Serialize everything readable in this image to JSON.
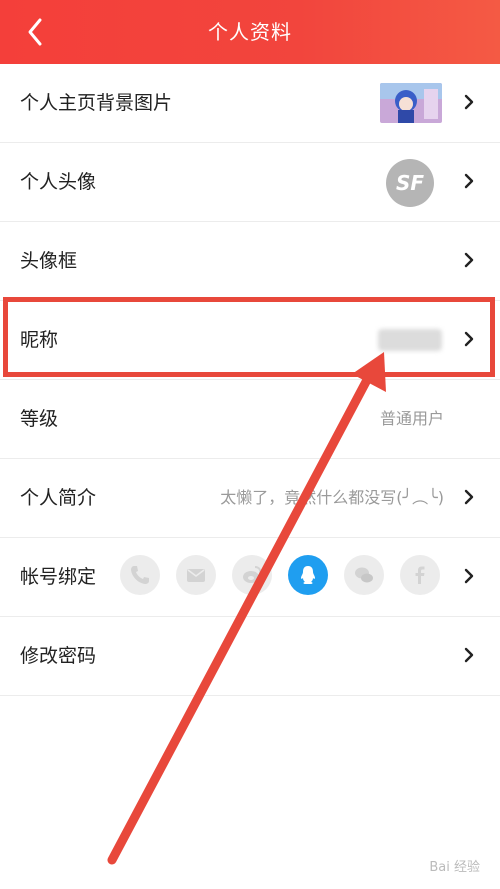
{
  "header": {
    "title": "个人资料"
  },
  "rows": [
    {
      "label": "个人主页背景图片",
      "value": ""
    },
    {
      "label": "个人头像",
      "value": ""
    },
    {
      "label": "头像框",
      "value": ""
    },
    {
      "label": "昵称",
      "value": ""
    },
    {
      "label": "等级",
      "value": "普通用户"
    },
    {
      "label": "个人简介",
      "value": "太懒了，竟然什么都没写(╯︵╰)"
    },
    {
      "label": "帐号绑定",
      "value": ""
    },
    {
      "label": "修改密码",
      "value": ""
    }
  ],
  "avatar": {
    "text": "SF"
  },
  "bindings": [
    {
      "icon": "phone-icon",
      "bound": false
    },
    {
      "icon": "mail-icon",
      "bound": false
    },
    {
      "icon": "weibo-icon",
      "bound": false
    },
    {
      "icon": "qq-icon",
      "bound": true
    },
    {
      "icon": "wechat-icon",
      "bound": false
    },
    {
      "icon": "facebook-icon",
      "bound": false
    }
  ],
  "colors": {
    "accent": "#f43f3a",
    "highlight": "#e8483b",
    "qq": "#1f9ef0"
  },
  "watermark": "Bai 经验"
}
